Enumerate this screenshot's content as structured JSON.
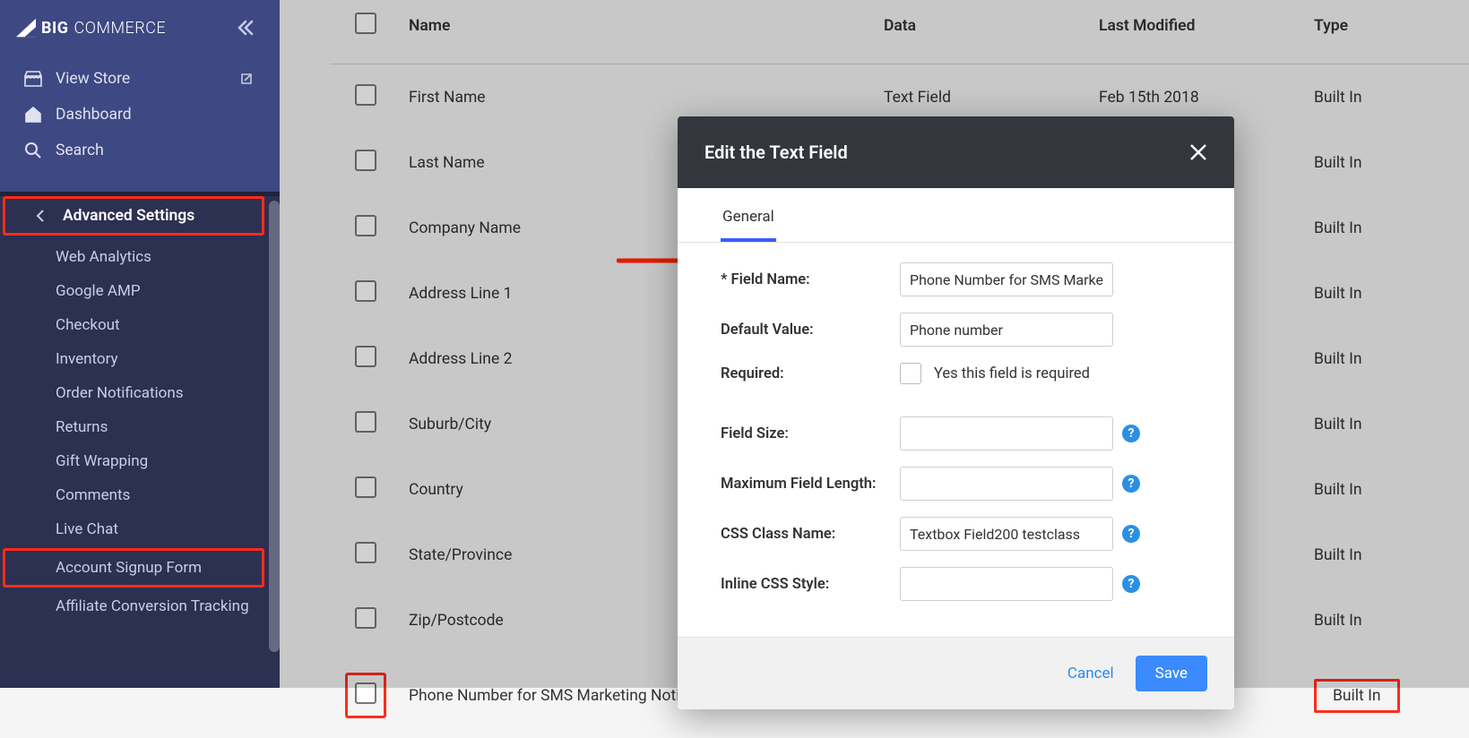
{
  "brand": {
    "big": "BIG",
    "commerce": "COMMERCE"
  },
  "sidebar": {
    "view_store": "View Store",
    "dashboard": "Dashboard",
    "search": "Search",
    "advanced": "Advanced Settings",
    "subs": [
      "Web Analytics",
      "Google AMP",
      "Checkout",
      "Inventory",
      "Order Notifications",
      "Returns",
      "Gift Wrapping",
      "Comments",
      "Live Chat",
      "Account Signup Form",
      "Affiliate Conversion Tracking"
    ]
  },
  "table": {
    "cols": {
      "name": "Name",
      "data": "Data",
      "last": "Last Modified",
      "type": "Type"
    },
    "rows": [
      {
        "name": "First Name",
        "data": "Text Field",
        "last": "Feb 15th 2018",
        "type": "Built In"
      },
      {
        "name": "Last Name",
        "data": "",
        "last": "",
        "type": "Built In"
      },
      {
        "name": "Company Name",
        "data": "",
        "last": "",
        "type": "Built In"
      },
      {
        "name": "Address Line 1",
        "data": "",
        "last": "",
        "type": "Built In"
      },
      {
        "name": "Address Line 2",
        "data": "",
        "last": "",
        "type": "Built In"
      },
      {
        "name": "Suburb/City",
        "data": "",
        "last": "",
        "type": "Built In"
      },
      {
        "name": "Country",
        "data": "",
        "last": "",
        "type": "Built In"
      },
      {
        "name": "State/Province",
        "data": "",
        "last": "",
        "type": "Built In"
      },
      {
        "name": "Zip/Postcode",
        "data": "",
        "last": "",
        "type": "Built In"
      },
      {
        "name": "Phone Number for SMS Marketing Notific",
        "data": "",
        "last": "",
        "type": "Built In"
      }
    ]
  },
  "modal": {
    "title": "Edit the Text Field",
    "tab": "General",
    "labels": {
      "field_name": "Field Name:",
      "default_value": "Default Value:",
      "required": "Required:",
      "required_text": "Yes this field is required",
      "field_size": "Field Size:",
      "max_len": "Maximum Field Length:",
      "css_class": "CSS Class Name:",
      "inline_css": "Inline CSS Style:"
    },
    "values": {
      "field_name": "Phone Number for SMS Marke",
      "default_value": "Phone number",
      "field_size": "",
      "max_len": "",
      "css_class": "Textbox Field200 testclass",
      "inline_css": ""
    },
    "buttons": {
      "cancel": "Cancel",
      "save": "Save"
    }
  }
}
